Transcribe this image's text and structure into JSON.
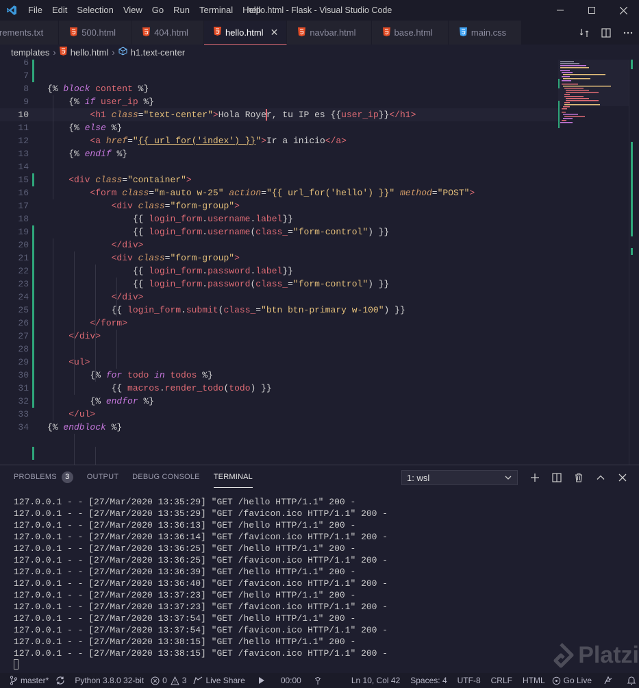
{
  "window": {
    "title": "hello.html - Flask - Visual Studio Code",
    "menu": [
      "File",
      "Edit",
      "Selection",
      "View",
      "Go",
      "Run",
      "Terminal",
      "Help"
    ]
  },
  "tabs": [
    {
      "label": "irements.txt",
      "icon": "text-file-icon",
      "active": false
    },
    {
      "label": "500.html",
      "icon": "html-icon",
      "active": false
    },
    {
      "label": "404.html",
      "icon": "html-icon",
      "active": false
    },
    {
      "label": "hello.html",
      "icon": "html-icon",
      "active": true
    },
    {
      "label": "navbar.html",
      "icon": "html-icon",
      "active": false
    },
    {
      "label": "base.html",
      "icon": "html-icon",
      "active": false
    },
    {
      "label": "main.css",
      "icon": "css-icon",
      "active": false
    }
  ],
  "breadcrumb": {
    "folder": "templates",
    "file": "hello.html",
    "symbol": "h1.text-center"
  },
  "editor": {
    "current_line": 10,
    "lines": [
      {
        "n": "6",
        "tokens": []
      },
      {
        "n": "7",
        "tokens": []
      },
      {
        "n": "8",
        "tokens": [
          [
            "k-brace",
            "{% "
          ],
          [
            "k-kw",
            "block"
          ],
          [
            "k-var",
            " content"
          ],
          [
            "k-brace",
            " %}"
          ]
        ]
      },
      {
        "n": "9",
        "tokens": [
          [
            "k-text",
            "    "
          ],
          [
            "k-brace",
            "{% "
          ],
          [
            "k-kw",
            "if"
          ],
          [
            "k-var",
            " user_ip"
          ],
          [
            "k-brace",
            " %}"
          ]
        ]
      },
      {
        "n": "10",
        "tokens": [
          [
            "k-text",
            "        "
          ],
          [
            "k-tag",
            "<h1"
          ],
          [
            "k-text",
            " "
          ],
          [
            "k-attr",
            "class"
          ],
          [
            "k-text",
            "="
          ],
          [
            "k-str",
            "\"text-center\""
          ],
          [
            "k-tag",
            ">"
          ],
          [
            "k-text",
            "Hola Roye"
          ],
          [
            "cursor",
            ""
          ],
          [
            "k-text",
            "r, tu IP es {{"
          ],
          [
            "k-var",
            "user_ip"
          ],
          [
            "k-text",
            "}}"
          ],
          [
            "k-tag",
            "</h1>"
          ]
        ]
      },
      {
        "n": "11",
        "tokens": [
          [
            "k-text",
            "    "
          ],
          [
            "k-brace",
            "{% "
          ],
          [
            "k-kw",
            "else"
          ],
          [
            "k-brace",
            " %}"
          ]
        ]
      },
      {
        "n": "12",
        "tokens": [
          [
            "k-text",
            "        "
          ],
          [
            "k-tag",
            "<a"
          ],
          [
            "k-text",
            " "
          ],
          [
            "k-attr",
            "href"
          ],
          [
            "k-text",
            "="
          ],
          [
            "k-str",
            "\""
          ],
          [
            "k-str k-und",
            "{{ url_for('index') }}"
          ],
          [
            "k-str",
            "\""
          ],
          [
            "k-tag",
            ">"
          ],
          [
            "k-text",
            "Ir a inicio"
          ],
          [
            "k-tag",
            "</a>"
          ]
        ]
      },
      {
        "n": "13",
        "tokens": [
          [
            "k-text",
            "    "
          ],
          [
            "k-brace",
            "{% "
          ],
          [
            "k-kw",
            "endif"
          ],
          [
            "k-brace",
            " %}"
          ]
        ]
      },
      {
        "n": "14",
        "tokens": []
      },
      {
        "n": "15",
        "tokens": [
          [
            "k-text",
            "    "
          ],
          [
            "k-tag",
            "<div"
          ],
          [
            "k-text",
            " "
          ],
          [
            "k-attr",
            "class"
          ],
          [
            "k-text",
            "="
          ],
          [
            "k-str",
            "\"container\""
          ],
          [
            "k-tag",
            ">"
          ]
        ]
      },
      {
        "n": "16",
        "tokens": [
          [
            "k-text",
            "        "
          ],
          [
            "k-tag",
            "<form"
          ],
          [
            "k-text",
            " "
          ],
          [
            "k-attr",
            "class"
          ],
          [
            "k-text",
            "="
          ],
          [
            "k-str",
            "\"m-auto w-25\""
          ],
          [
            "k-text",
            " "
          ],
          [
            "k-attr",
            "action"
          ],
          [
            "k-text",
            "="
          ],
          [
            "k-str",
            "\"{{ url_for('hello') }}\""
          ],
          [
            "k-text",
            " "
          ],
          [
            "k-attr",
            "method"
          ],
          [
            "k-text",
            "="
          ],
          [
            "k-str",
            "\"POST\""
          ],
          [
            "k-tag",
            ">"
          ]
        ]
      },
      {
        "n": "17",
        "tokens": [
          [
            "k-text",
            "            "
          ],
          [
            "k-tag",
            "<div"
          ],
          [
            "k-text",
            " "
          ],
          [
            "k-attr",
            "class"
          ],
          [
            "k-text",
            "="
          ],
          [
            "k-str",
            "\"form-group\""
          ],
          [
            "k-tag",
            ">"
          ]
        ]
      },
      {
        "n": "18",
        "tokens": [
          [
            "k-text",
            "                {{ "
          ],
          [
            "k-var",
            "login_form"
          ],
          [
            "k-text",
            "."
          ],
          [
            "k-var",
            "username"
          ],
          [
            "k-text",
            "."
          ],
          [
            "k-var",
            "label"
          ],
          [
            "k-text",
            "}}"
          ]
        ]
      },
      {
        "n": "19",
        "tokens": [
          [
            "k-text",
            "                {{ "
          ],
          [
            "k-var",
            "login_form"
          ],
          [
            "k-text",
            "."
          ],
          [
            "k-fn",
            "username"
          ],
          [
            "k-text",
            "("
          ],
          [
            "k-var",
            "class_"
          ],
          [
            "k-text",
            "="
          ],
          [
            "k-str",
            "\"form-control\""
          ],
          [
            "k-text",
            ") }}"
          ]
        ]
      },
      {
        "n": "20",
        "tokens": [
          [
            "k-text",
            "            "
          ],
          [
            "k-tag",
            "</div>"
          ]
        ]
      },
      {
        "n": "21",
        "tokens": [
          [
            "k-text",
            "            "
          ],
          [
            "k-tag",
            "<div"
          ],
          [
            "k-text",
            " "
          ],
          [
            "k-attr",
            "class"
          ],
          [
            "k-text",
            "="
          ],
          [
            "k-str",
            "\"form-group\""
          ],
          [
            "k-tag",
            ">"
          ]
        ]
      },
      {
        "n": "22",
        "tokens": [
          [
            "k-text",
            "                {{ "
          ],
          [
            "k-var",
            "login_form"
          ],
          [
            "k-text",
            "."
          ],
          [
            "k-var",
            "password"
          ],
          [
            "k-text",
            "."
          ],
          [
            "k-var",
            "label"
          ],
          [
            "k-text",
            "}}"
          ]
        ]
      },
      {
        "n": "23",
        "tokens": [
          [
            "k-text",
            "                {{ "
          ],
          [
            "k-var",
            "login_form"
          ],
          [
            "k-text",
            "."
          ],
          [
            "k-fn",
            "password"
          ],
          [
            "k-text",
            "("
          ],
          [
            "k-var",
            "class_"
          ],
          [
            "k-text",
            "="
          ],
          [
            "k-str",
            "\"form-control\""
          ],
          [
            "k-text",
            ") }}"
          ]
        ]
      },
      {
        "n": "24",
        "tokens": [
          [
            "k-text",
            "            "
          ],
          [
            "k-tag",
            "</div>"
          ]
        ]
      },
      {
        "n": "25",
        "tokens": [
          [
            "k-text",
            "            {{ "
          ],
          [
            "k-var",
            "login_form"
          ],
          [
            "k-text",
            "."
          ],
          [
            "k-fn",
            "submit"
          ],
          [
            "k-text",
            "("
          ],
          [
            "k-var",
            "class_"
          ],
          [
            "k-text",
            "="
          ],
          [
            "k-str",
            "\"btn btn-primary w-100\""
          ],
          [
            "k-text",
            ") }}"
          ]
        ]
      },
      {
        "n": "26",
        "tokens": [
          [
            "k-text",
            "        "
          ],
          [
            "k-tag",
            "</form>"
          ]
        ]
      },
      {
        "n": "27",
        "tokens": [
          [
            "k-text",
            "    "
          ],
          [
            "k-tag",
            "</div>"
          ]
        ]
      },
      {
        "n": "28",
        "tokens": []
      },
      {
        "n": "29",
        "tokens": [
          [
            "k-text",
            "    "
          ],
          [
            "k-tag",
            "<ul>"
          ]
        ]
      },
      {
        "n": "30",
        "tokens": [
          [
            "k-text",
            "        "
          ],
          [
            "k-brace",
            "{% "
          ],
          [
            "k-kw",
            "for"
          ],
          [
            "k-var",
            " todo"
          ],
          [
            "k-kw",
            " in"
          ],
          [
            "k-var",
            " todos"
          ],
          [
            "k-brace",
            " %}"
          ]
        ]
      },
      {
        "n": "31",
        "tokens": [
          [
            "k-text",
            "            {{ "
          ],
          [
            "k-var",
            "macros"
          ],
          [
            "k-text",
            "."
          ],
          [
            "k-fn",
            "render_todo"
          ],
          [
            "k-text",
            "("
          ],
          [
            "k-var",
            "todo"
          ],
          [
            "k-text",
            ") }}"
          ]
        ]
      },
      {
        "n": "32",
        "tokens": [
          [
            "k-text",
            "        "
          ],
          [
            "k-brace",
            "{% "
          ],
          [
            "k-kw",
            "endfor"
          ],
          [
            "k-brace",
            " %}"
          ]
        ]
      },
      {
        "n": "33",
        "tokens": [
          [
            "k-text",
            "    "
          ],
          [
            "k-tag",
            "</ul>"
          ]
        ]
      },
      {
        "n": "34",
        "tokens": [
          [
            "k-brace",
            "{% "
          ],
          [
            "k-kw",
            "endblock"
          ],
          [
            "k-brace",
            " %}"
          ]
        ]
      }
    ]
  },
  "panel": {
    "tabs": [
      {
        "label": "PROBLEMS",
        "badge": "3",
        "active": false
      },
      {
        "label": "OUTPUT",
        "active": false
      },
      {
        "label": "DEBUG CONSOLE",
        "active": false
      },
      {
        "label": "TERMINAL",
        "active": true
      }
    ],
    "terminal_selector": "1: wsl",
    "terminal_lines": [
      "127.0.0.1 - - [27/Mar/2020 13:35:29] \"GET /hello HTTP/1.1\" 200 -",
      "127.0.0.1 - - [27/Mar/2020 13:35:29] \"GET /favicon.ico HTTP/1.1\" 200 -",
      "127.0.0.1 - - [27/Mar/2020 13:36:13] \"GET /hello HTTP/1.1\" 200 -",
      "127.0.0.1 - - [27/Mar/2020 13:36:14] \"GET /favicon.ico HTTP/1.1\" 200 -",
      "127.0.0.1 - - [27/Mar/2020 13:36:25] \"GET /hello HTTP/1.1\" 200 -",
      "127.0.0.1 - - [27/Mar/2020 13:36:25] \"GET /favicon.ico HTTP/1.1\" 200 -",
      "127.0.0.1 - - [27/Mar/2020 13:36:39] \"GET /hello HTTP/1.1\" 200 -",
      "127.0.0.1 - - [27/Mar/2020 13:36:40] \"GET /favicon.ico HTTP/1.1\" 200 -",
      "127.0.0.1 - - [27/Mar/2020 13:37:23] \"GET /hello HTTP/1.1\" 200 -",
      "127.0.0.1 - - [27/Mar/2020 13:37:23] \"GET /favicon.ico HTTP/1.1\" 200 -",
      "127.0.0.1 - - [27/Mar/2020 13:37:54] \"GET /hello HTTP/1.1\" 200 -",
      "127.0.0.1 - - [27/Mar/2020 13:37:54] \"GET /favicon.ico HTTP/1.1\" 200 -",
      "127.0.0.1 - - [27/Mar/2020 13:38:15] \"GET /hello HTTP/1.1\" 200 -",
      "127.0.0.1 - - [27/Mar/2020 13:38:15] \"GET /favicon.ico HTTP/1.1\" 200 -"
    ],
    "watermark": "Platzi"
  },
  "statusbar": {
    "branch": "master*",
    "python": "Python 3.8.0 32-bit",
    "errors": "0",
    "warnings": "3",
    "live_share": "Live Share",
    "timer": "00:00",
    "position": "Ln 10, Col 42",
    "spaces": "Spaces: 4",
    "encoding": "UTF-8",
    "eol": "CRLF",
    "language": "HTML",
    "golive": "Go Live"
  },
  "colors": {
    "background": "#1e1e2e",
    "accent": "#e06c75",
    "git_added": "#2ea67a",
    "vscode_blue": "#3c99dc",
    "html_orange": "#e44d26",
    "css_blue": "#42a5f5"
  }
}
